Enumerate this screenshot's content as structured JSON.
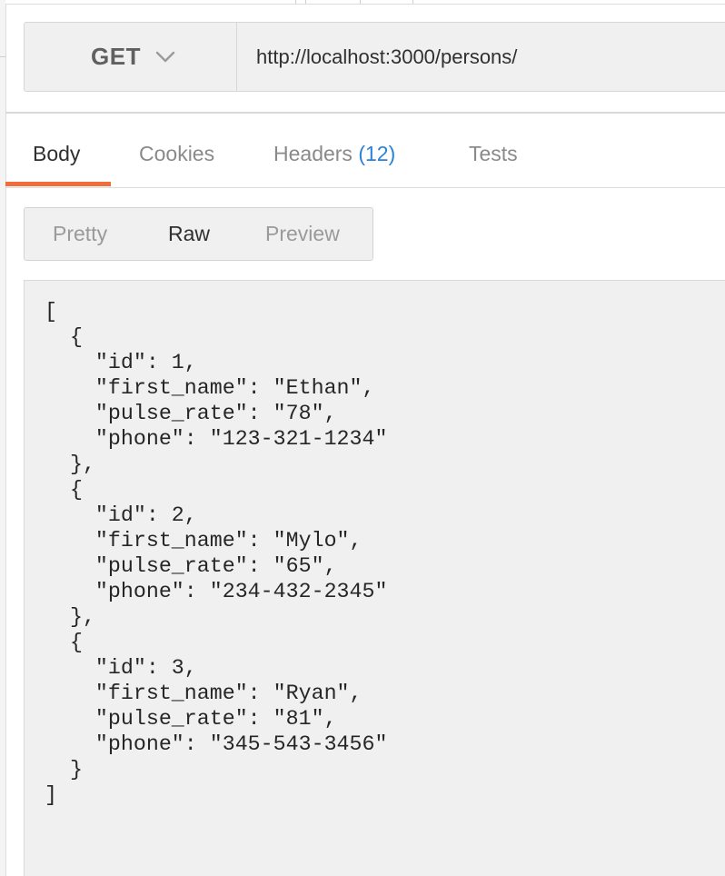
{
  "request": {
    "method": "GET",
    "url": "http://localhost:3000/persons/"
  },
  "response_tabs": [
    {
      "label": "Body",
      "active": true
    },
    {
      "label": "Cookies",
      "active": false
    },
    {
      "label": "Headers",
      "count": "(12)",
      "active": false
    },
    {
      "label": "Tests",
      "active": false
    }
  ],
  "format_tabs": [
    {
      "label": "Pretty",
      "active": false
    },
    {
      "label": "Raw",
      "active": true
    },
    {
      "label": "Preview",
      "active": false
    }
  ],
  "body_lines": [
    "[",
    "  {",
    "    \"id\": 1,",
    "    \"first_name\": \"Ethan\",",
    "    \"pulse_rate\": \"78\",",
    "    \"phone\": \"123-321-1234\"",
    "  },",
    "  {",
    "    \"id\": 2,",
    "    \"first_name\": \"Mylo\",",
    "    \"pulse_rate\": \"65\",",
    "    \"phone\": \"234-432-2345\"",
    "  },",
    "  {",
    "    \"id\": 3,",
    "    \"first_name\": \"Ryan\",",
    "    \"pulse_rate\": \"81\",",
    "    \"phone\": \"345-543-3456\"",
    "  }",
    "]"
  ],
  "colors": {
    "accent": "#f26b3a",
    "count": "#2b82d9"
  }
}
